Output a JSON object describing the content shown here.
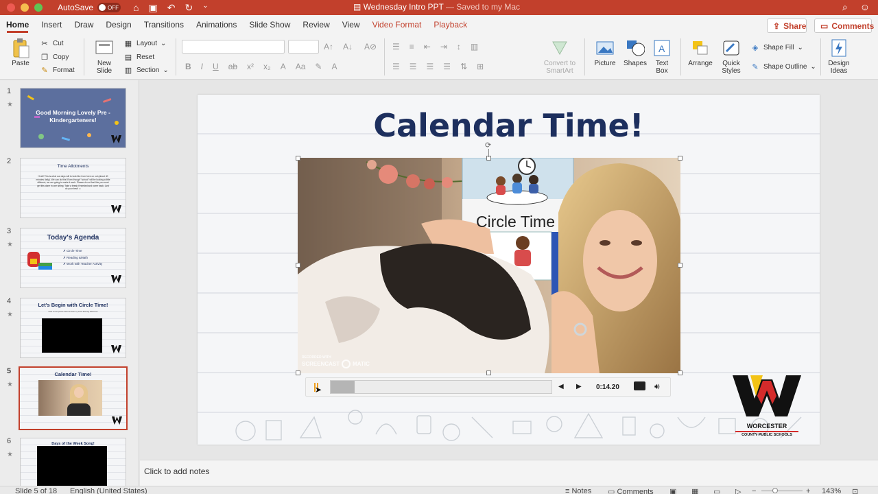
{
  "window": {
    "autosave_label": "AutoSave",
    "autosave_state": "OFF",
    "document_title": "Wednesday Intro PPT",
    "saved_status": "— Saved to my Mac"
  },
  "ribbon_tabs": [
    {
      "label": "Home",
      "active": true
    },
    {
      "label": "Insert"
    },
    {
      "label": "Draw"
    },
    {
      "label": "Design"
    },
    {
      "label": "Transitions"
    },
    {
      "label": "Animations"
    },
    {
      "label": "Slide Show"
    },
    {
      "label": "Review"
    },
    {
      "label": "View"
    },
    {
      "label": "Video Format",
      "contextual": true
    },
    {
      "label": "Playback",
      "contextual": true
    }
  ],
  "header_buttons": {
    "share": "Share",
    "comments": "Comments"
  },
  "ribbon": {
    "paste": "Paste",
    "cut": "Cut",
    "copy": "Copy",
    "format": "Format",
    "new_slide_1": "New",
    "new_slide_2": "Slide",
    "layout": "Layout",
    "reset": "Reset",
    "section": "Section",
    "convert_1": "Convert to",
    "convert_2": "SmartArt",
    "picture": "Picture",
    "shapes": "Shapes",
    "text_box_1": "Text",
    "text_box_2": "Box",
    "arrange": "Arrange",
    "quick_styles_1": "Quick",
    "quick_styles_2": "Styles",
    "shape_fill": "Shape Fill",
    "shape_outline": "Shape Outline",
    "design_ideas_1": "Design",
    "design_ideas_2": "Ideas"
  },
  "thumbnails": [
    {
      "num": "1",
      "title": "Good Morning Lovely Pre - Kindergarteners!"
    },
    {
      "num": "2",
      "title": "Time Allotments",
      "body": "Hi all! This is what our days will to look like from here on out (about 40 minutes daily). We can do this! Even though \"school\" will be looking a little different, we are going to make it work. Please do not feel like you must get this done in one sitting. Take a break if needed and come back. Just do your best! ☺"
    },
    {
      "num": "3",
      "title": "Today's Agenda",
      "items": [
        "Circle Time",
        "Reading &Math",
        "Work with Teacher Activity"
      ]
    },
    {
      "num": "4",
      "title": "Let's Begin with Circle Time!",
      "caption": "Click on the picture below to hear my Good Morning Welcome!"
    },
    {
      "num": "5",
      "title": "Calendar Time!"
    },
    {
      "num": "6",
      "title": "Days of the Week Song!"
    }
  ],
  "slide": {
    "title": "Calendar Time!",
    "video_sign": "Circle Time",
    "watermark_1": "RECORDED WITH",
    "watermark_2": "SCREENCAST",
    "watermark_3": "MATIC",
    "time": "0:14.20",
    "progress_fraction": 0.11,
    "logo_line_1": "WORCESTER",
    "logo_line_2": "COUNTY PUBLIC SCHOOLS"
  },
  "notes_placeholder": "Click to add notes",
  "status": {
    "slide_pos": "Slide 5 of 18",
    "language": "English (United States)",
    "notes": "Notes",
    "comments": "Comments",
    "zoom": "143%"
  },
  "colors": {
    "accent": "#c2402c",
    "title_navy": "#1d2f5e",
    "logo_yellow": "#f3c316",
    "logo_red": "#d42b2b"
  }
}
